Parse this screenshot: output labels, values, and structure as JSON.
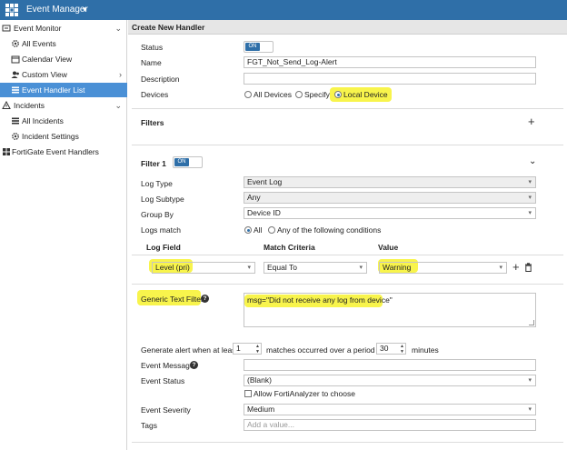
{
  "topbar": {
    "title": "Event Manager",
    "chevron": "▾",
    "logo_icon": "fortinet-grid-icon",
    "bg_color": "#2f6fa8"
  },
  "sidebar": {
    "active_color": "#4a90d6",
    "items": [
      {
        "label": "Event Monitor",
        "icon": "event-monitor-icon",
        "arrow": "⌄"
      },
      {
        "label": "All Events",
        "icon": "gear-icon"
      },
      {
        "label": "Calendar View",
        "icon": "calendar-icon"
      },
      {
        "label": "Custom View",
        "icon": "users-icon",
        "arrow": "›"
      },
      {
        "label": "Event Handler List",
        "icon": "list-icon",
        "active": true
      },
      {
        "label": "Incidents",
        "icon": "incidents-icon",
        "arrow": "⌄"
      },
      {
        "label": "All Incidents",
        "icon": "list-icon"
      },
      {
        "label": "Incident Settings",
        "icon": "settings-icon"
      },
      {
        "label": "FortiGate Event Handlers",
        "icon": "fortigate-icon"
      }
    ]
  },
  "main": {
    "header": "Create New Handler",
    "status_label": "Status",
    "status_toggle": "ON",
    "name_label": "Name",
    "name_value": "FGT_Not_Send_Log-Alert",
    "description_label": "Description",
    "description_value": "",
    "devices_label": "Devices",
    "devices_options": [
      "All Devices",
      "Specify",
      "Local Device"
    ],
    "devices_selected": "Local Device",
    "filters_title": "Filters",
    "filter1_title": "Filter 1",
    "filter1_toggle": "ON",
    "log_type_label": "Log Type",
    "log_type_value": "Event Log",
    "log_subtype_label": "Log Subtype",
    "log_subtype_value": "Any",
    "group_by_label": "Group By",
    "group_by_value": "Device ID",
    "logs_match_label": "Logs match",
    "logs_match_options": [
      "All",
      "Any of the following conditions"
    ],
    "logs_match_selected": "All",
    "col_log_field": "Log Field",
    "col_match_criteria": "Match Criteria",
    "col_value": "Value",
    "row_log_field": "Level (pri)",
    "row_match_criteria": "Equal To",
    "row_value": "Warning",
    "generic_filter_label": "Generic Text Filter",
    "generic_filter_value": "msg=\"Did not receive any log from device\"",
    "alert_prefix": "Generate alert when at least",
    "alert_count": "1",
    "alert_middle": "matches occurred over a period of",
    "alert_period": "30",
    "alert_suffix": "minutes",
    "event_message_label": "Event Message",
    "event_message_value": "",
    "event_status_label": "Event Status",
    "event_status_value": "(Blank)",
    "allow_fortianalyzer_label": "Allow FortiAnalyzer to choose",
    "event_severity_label": "Event Severity",
    "event_severity_value": "Medium",
    "tags_label": "Tags",
    "tags_placeholder": "Add a value...",
    "highlight_color": "#f7f22d"
  }
}
